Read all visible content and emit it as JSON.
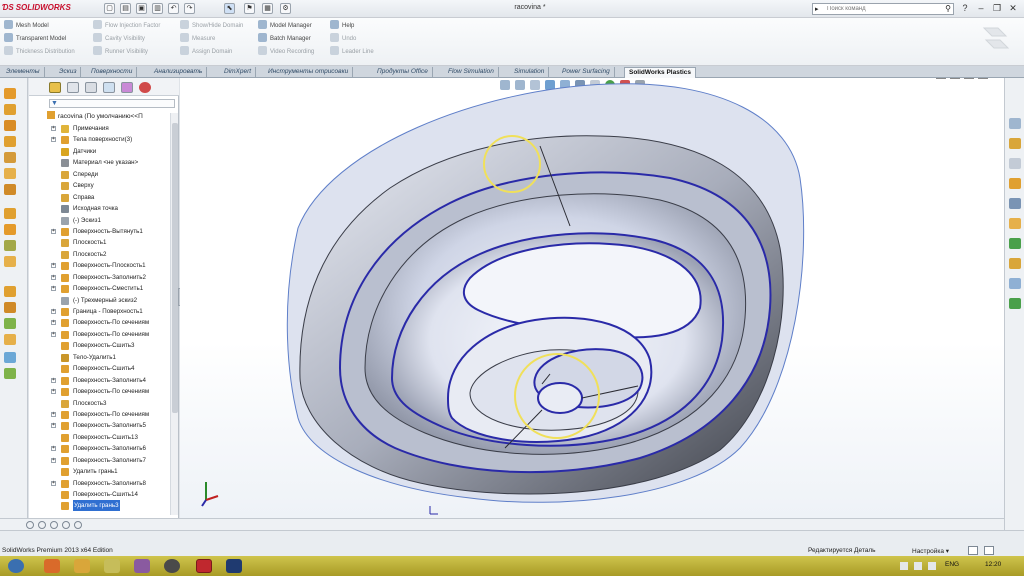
{
  "app": {
    "logo_text": "SOLIDWORKS",
    "document_title": "racovina *",
    "search_placeholder": "Поиск команд"
  },
  "ribbon": {
    "col1": [
      "Mesh Model",
      "Transparent Model",
      "Thickness Distribution"
    ],
    "col2": [
      "Flow Injection Factor",
      "Cavity Visibility",
      "Runner Visibility"
    ],
    "col3": [
      "Show/Hide Domain",
      "Measure",
      "Assign Domain"
    ],
    "col4": [
      "Model Manager",
      "Batch Manager",
      "Video Recording"
    ],
    "col5": [
      "Help",
      "Undo",
      "Leader Line"
    ]
  },
  "tabs": [
    "Элементы",
    "Эскиз",
    "Поверхности",
    "Анализировать",
    "DimXpert",
    "Инструменты отрисовки",
    "Продукты Office",
    "Flow Simulation",
    "Simulation",
    "Power Surfacing",
    "SolidWorks Plastics"
  ],
  "active_tab_index": 10,
  "feature_tree": {
    "root": "racovina  (По умолчанию<<П",
    "items": [
      {
        "label": "Примечания",
        "exp": "+",
        "color": "#e0b43a"
      },
      {
        "label": "Тела поверхности(3)",
        "exp": "+",
        "color": "#e0a030"
      },
      {
        "label": "Датчики",
        "exp": "",
        "color": "#d9a520"
      },
      {
        "label": "Материал <не указан>",
        "exp": "",
        "color": "#8a8f96"
      },
      {
        "label": "Спереди",
        "exp": "",
        "color": "#d9a63a"
      },
      {
        "label": "Сверху",
        "exp": "",
        "color": "#d9a63a"
      },
      {
        "label": "Справа",
        "exp": "",
        "color": "#d9a63a"
      },
      {
        "label": "Исходная точка",
        "exp": "",
        "color": "#7d8894"
      },
      {
        "label": "(-) Эскиз1",
        "exp": "",
        "color": "#9aa3ad"
      },
      {
        "label": "Поверхность-Вытянуть1",
        "exp": "+",
        "color": "#e0a030"
      },
      {
        "label": "Плоскость1",
        "exp": "",
        "color": "#d9a63a"
      },
      {
        "label": "Плоскость2",
        "exp": "",
        "color": "#d9a63a"
      },
      {
        "label": "Поверхность-Плоскость1",
        "exp": "+",
        "color": "#e0a030"
      },
      {
        "label": "Поверхность-Заполнить2",
        "exp": "+",
        "color": "#e0a030"
      },
      {
        "label": "Поверхность-Сместить1",
        "exp": "+",
        "color": "#e0a030"
      },
      {
        "label": "(-) Трехмерный эскиз2",
        "exp": "",
        "color": "#9aa3ad"
      },
      {
        "label": "Граница - Поверхность1",
        "exp": "+",
        "color": "#e0a030"
      },
      {
        "label": "Поверхность-По сечениям",
        "exp": "+",
        "color": "#e0a030"
      },
      {
        "label": "Поверхность-По сечениям",
        "exp": "+",
        "color": "#e0a030"
      },
      {
        "label": "Поверхность-Сшить3",
        "exp": "",
        "color": "#e0a030"
      },
      {
        "label": "Тело-Удалить1",
        "exp": "",
        "color": "#c9962a"
      },
      {
        "label": "Поверхность-Сшить4",
        "exp": "",
        "color": "#e0a030"
      },
      {
        "label": "Поверхность-Заполнить4",
        "exp": "+",
        "color": "#e0a030"
      },
      {
        "label": "Поверхность-По сечениям",
        "exp": "+",
        "color": "#e0a030"
      },
      {
        "label": "Плоскость3",
        "exp": "",
        "color": "#d9a63a"
      },
      {
        "label": "Поверхность-По сечениям",
        "exp": "+",
        "color": "#e0a030"
      },
      {
        "label": "Поверхность-Заполнить5",
        "exp": "+",
        "color": "#e0a030"
      },
      {
        "label": "Поверхность-Сшить13",
        "exp": "",
        "color": "#e0a030"
      },
      {
        "label": "Поверхность-Заполнить6",
        "exp": "+",
        "color": "#e0a030"
      },
      {
        "label": "Поверхность-Заполнить7",
        "exp": "+",
        "color": "#e0a030"
      },
      {
        "label": "Удалить грань1",
        "exp": "",
        "color": "#e0a030"
      },
      {
        "label": "Поверхность-Заполнить8",
        "exp": "+",
        "color": "#e0a030"
      },
      {
        "label": "Поверхность-Сшить14",
        "exp": "",
        "color": "#e0a030"
      },
      {
        "label": "Удалить грань3",
        "exp": "",
        "color": "#e0a030",
        "selected": true
      }
    ]
  },
  "status": {
    "left": "SolidWorks Premium 2013 x64 Edition",
    "mode": "Редактируется Деталь",
    "settings": "Настройка"
  },
  "tray": {
    "lang": "ENG",
    "time": "12:20"
  },
  "colors": {
    "surface_light": "#f1f4fa",
    "surface_mid": "#c9d0e4",
    "surface_dark": "#4a4d55",
    "edge_blue": "#2a2aa8",
    "highlight_circle": "#f0e05a",
    "sheet_fill": "#dde2ef"
  }
}
